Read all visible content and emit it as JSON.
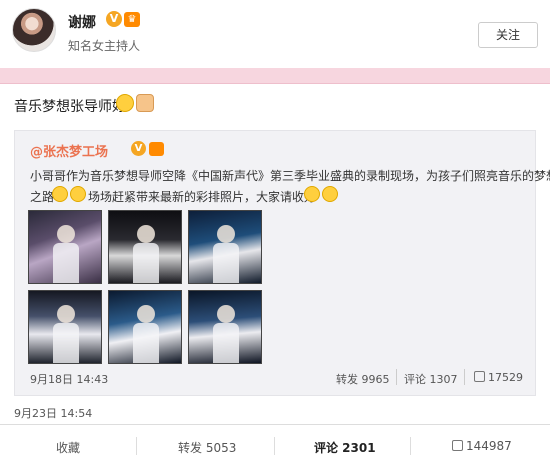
{
  "author": {
    "name": "谢娜",
    "description": "知名女主持人",
    "verified_badge": "V"
  },
  "follow_button": "关注",
  "post": {
    "text": "音乐梦想张导师好",
    "date": "9月23日 14:54"
  },
  "repost": {
    "author": "@张杰梦工场",
    "verified_badge": "V",
    "line1": "小哥哥作为音乐梦想导师空降《中国新声代》第三季毕业盛典的录制现场，为孩子们照亮音乐的梦想",
    "line2_start": "之路",
    "line2_end": "场场赶紧带来最新的彩排照片，大家请收好",
    "date": "9月18日 14:43",
    "stats": {
      "repost": "转发 9965",
      "comment": "评论 1307",
      "like": "17529"
    }
  },
  "footer": {
    "favorite": "收藏",
    "repost": "转发 5053",
    "comment": "评论 2301",
    "like": "144987"
  }
}
